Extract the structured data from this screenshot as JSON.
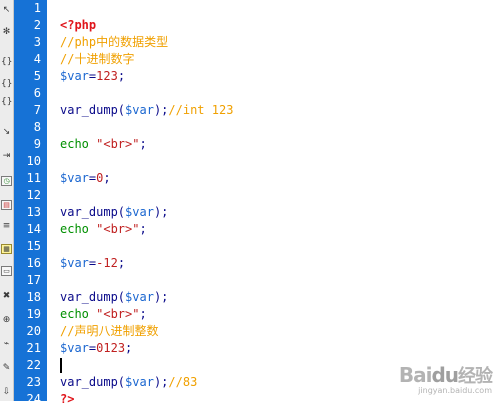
{
  "toolbar": {
    "icons": [
      "cursor-icon",
      "asterisk-icon",
      "brace-icon",
      "brace-icon",
      "brace-icon",
      "arrow-icon",
      "indent-icon",
      "snippet-icon",
      "highlight-icon",
      "code-icon",
      "format-icon",
      "widget-icon",
      "comment-icon",
      "insert-icon",
      "tag-icon",
      "brush-icon",
      "scroll-icon"
    ]
  },
  "gutter": {
    "line_numbers": [
      "1",
      "2",
      "3",
      "4",
      "5",
      "6",
      "7",
      "8",
      "9",
      "10",
      "11",
      "12",
      "13",
      "14",
      "15",
      "16",
      "17",
      "18",
      "19",
      "20",
      "21",
      "22",
      "23",
      "24"
    ]
  },
  "code": {
    "lines": [
      [],
      [
        {
          "t": "<?php",
          "c": "tag"
        }
      ],
      [
        {
          "t": "//php中的数据类型",
          "c": "cmt"
        }
      ],
      [
        {
          "t": "//十进制数字",
          "c": "cmt"
        }
      ],
      [
        {
          "t": "$var",
          "c": "var"
        },
        {
          "t": "=",
          "c": "op"
        },
        {
          "t": "123",
          "c": "num"
        },
        {
          "t": ";",
          "c": "op"
        }
      ],
      [],
      [
        {
          "t": "var_dump",
          "c": "fn"
        },
        {
          "t": "(",
          "c": "op"
        },
        {
          "t": "$var",
          "c": "var"
        },
        {
          "t": ");",
          "c": "op"
        },
        {
          "t": "//int 123",
          "c": "cmt"
        }
      ],
      [],
      [
        {
          "t": "echo ",
          "c": "kw"
        },
        {
          "t": "\"<br>\"",
          "c": "str"
        },
        {
          "t": ";",
          "c": "op"
        }
      ],
      [],
      [
        {
          "t": "$var",
          "c": "var"
        },
        {
          "t": "=",
          "c": "op"
        },
        {
          "t": "0",
          "c": "num"
        },
        {
          "t": ";",
          "c": "op"
        }
      ],
      [],
      [
        {
          "t": "var_dump",
          "c": "fn"
        },
        {
          "t": "(",
          "c": "op"
        },
        {
          "t": "$var",
          "c": "var"
        },
        {
          "t": ");",
          "c": "op"
        }
      ],
      [
        {
          "t": "echo ",
          "c": "kw"
        },
        {
          "t": "\"<br>\"",
          "c": "str"
        },
        {
          "t": ";",
          "c": "op"
        }
      ],
      [],
      [
        {
          "t": "$var",
          "c": "var"
        },
        {
          "t": "=",
          "c": "op"
        },
        {
          "t": "-12",
          "c": "num"
        },
        {
          "t": ";",
          "c": "op"
        }
      ],
      [],
      [
        {
          "t": "var_dump",
          "c": "fn"
        },
        {
          "t": "(",
          "c": "op"
        },
        {
          "t": "$var",
          "c": "var"
        },
        {
          "t": ");",
          "c": "op"
        }
      ],
      [
        {
          "t": "echo ",
          "c": "kw"
        },
        {
          "t": "\"<br>\"",
          "c": "str"
        },
        {
          "t": ";",
          "c": "op"
        }
      ],
      [
        {
          "t": "//声明八进制整数",
          "c": "cmt"
        }
      ],
      [
        {
          "t": "$var",
          "c": "var"
        },
        {
          "t": "=",
          "c": "op"
        },
        {
          "t": "0123",
          "c": "num"
        },
        {
          "t": ";",
          "c": "op"
        }
      ],
      [],
      [
        {
          "t": "var_dump",
          "c": "fn"
        },
        {
          "t": "(",
          "c": "op"
        },
        {
          "t": "$var",
          "c": "var"
        },
        {
          "t": ");",
          "c": "op"
        },
        {
          "t": "//83",
          "c": "cmt"
        }
      ],
      [
        {
          "t": "?>",
          "c": "tag"
        }
      ]
    ]
  },
  "cursor": {
    "line": 22
  },
  "watermark": {
    "brand_left": "Bai",
    "brand_paw": "du",
    "brand_cn": "经验",
    "site": "jingyan.baidu.com"
  },
  "colors": {
    "gutter": "#1672d6",
    "tag": "#e0151b",
    "comment": "#f0a000",
    "variable": "#1a66d0",
    "keyword": "#009000",
    "string": "#c02020"
  }
}
